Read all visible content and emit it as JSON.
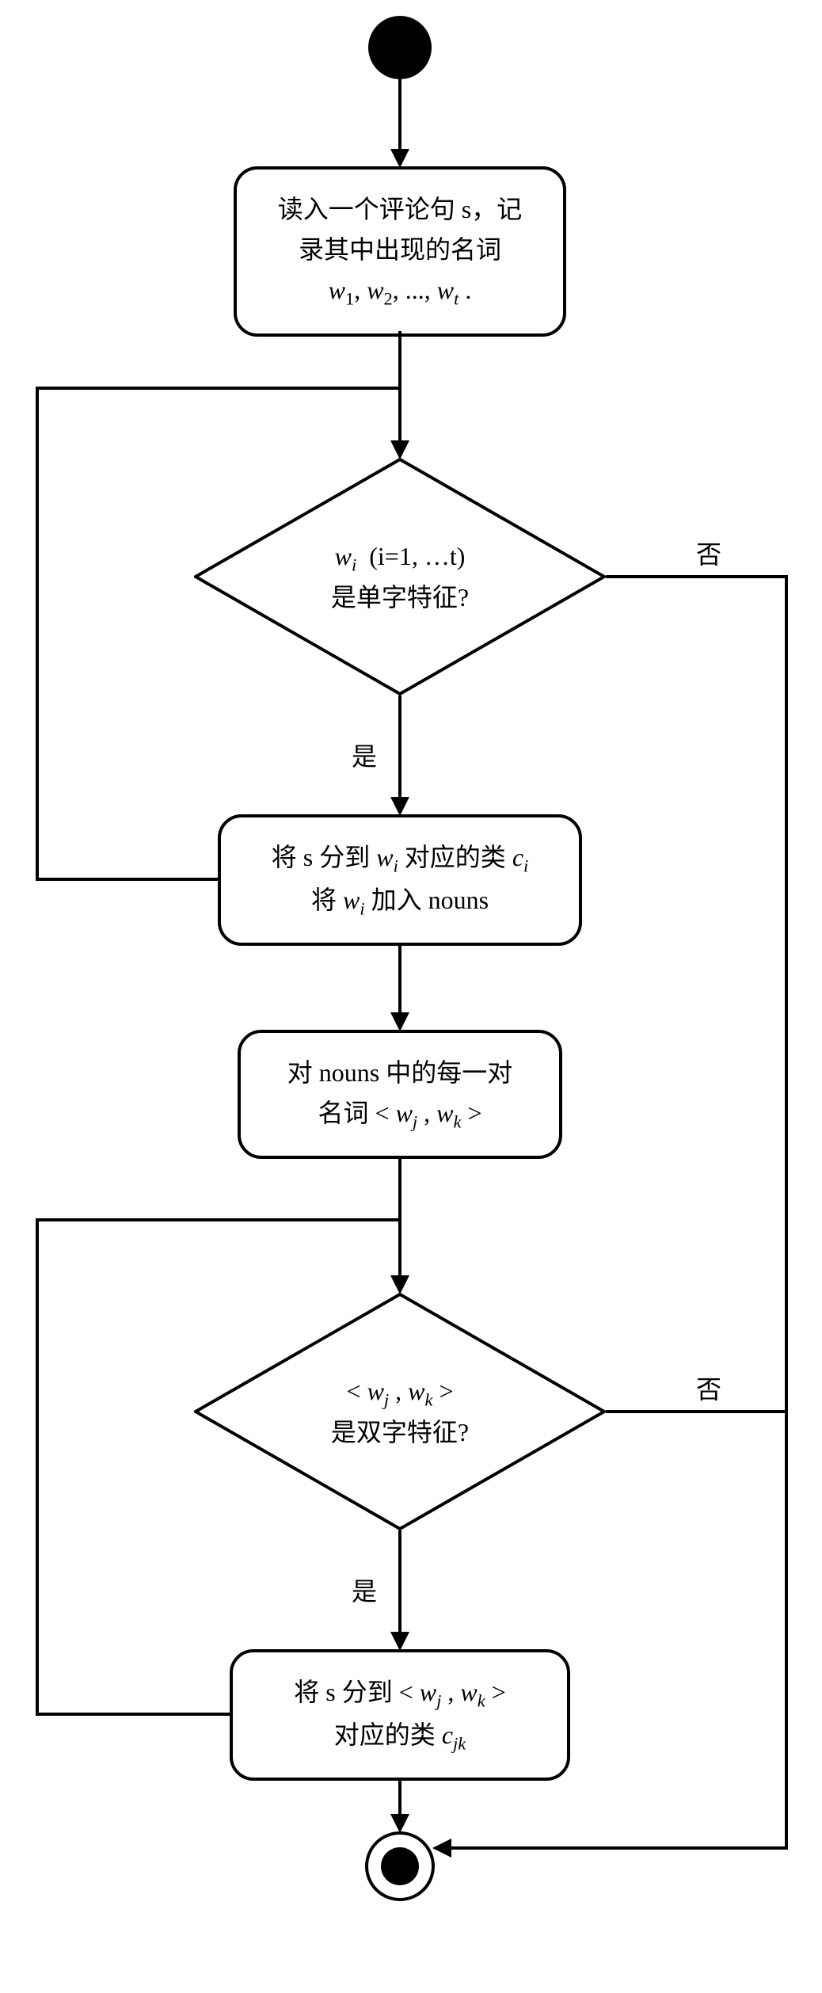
{
  "nodes": {
    "start": {
      "type": "start"
    },
    "step1": {
      "line1": "读入一个评论句 s，记",
      "line2": "录其中出现的名词",
      "formula": "w₁, w₂, ..., wₜ ."
    },
    "decision1": {
      "line1": "wᵢ  (i=1, …t)",
      "line2": "是单字特征?"
    },
    "step2": {
      "line1": "将 s 分到 wᵢ 对应的类 cᵢ",
      "line2": "将 wᵢ 加入 nouns"
    },
    "step3": {
      "line1": "对 nouns 中的每一对",
      "line2": "名词 < wⱼ , wₖ >"
    },
    "decision2": {
      "line1": "< wⱼ , wₖ >",
      "line2": "是双字特征?"
    },
    "step4": {
      "line1": "将 s 分到 < wⱼ , wₖ >",
      "line2": "对应的类 cⱼₖ"
    },
    "end": {
      "type": "end"
    }
  },
  "labels": {
    "yes": "是",
    "no": "否"
  }
}
